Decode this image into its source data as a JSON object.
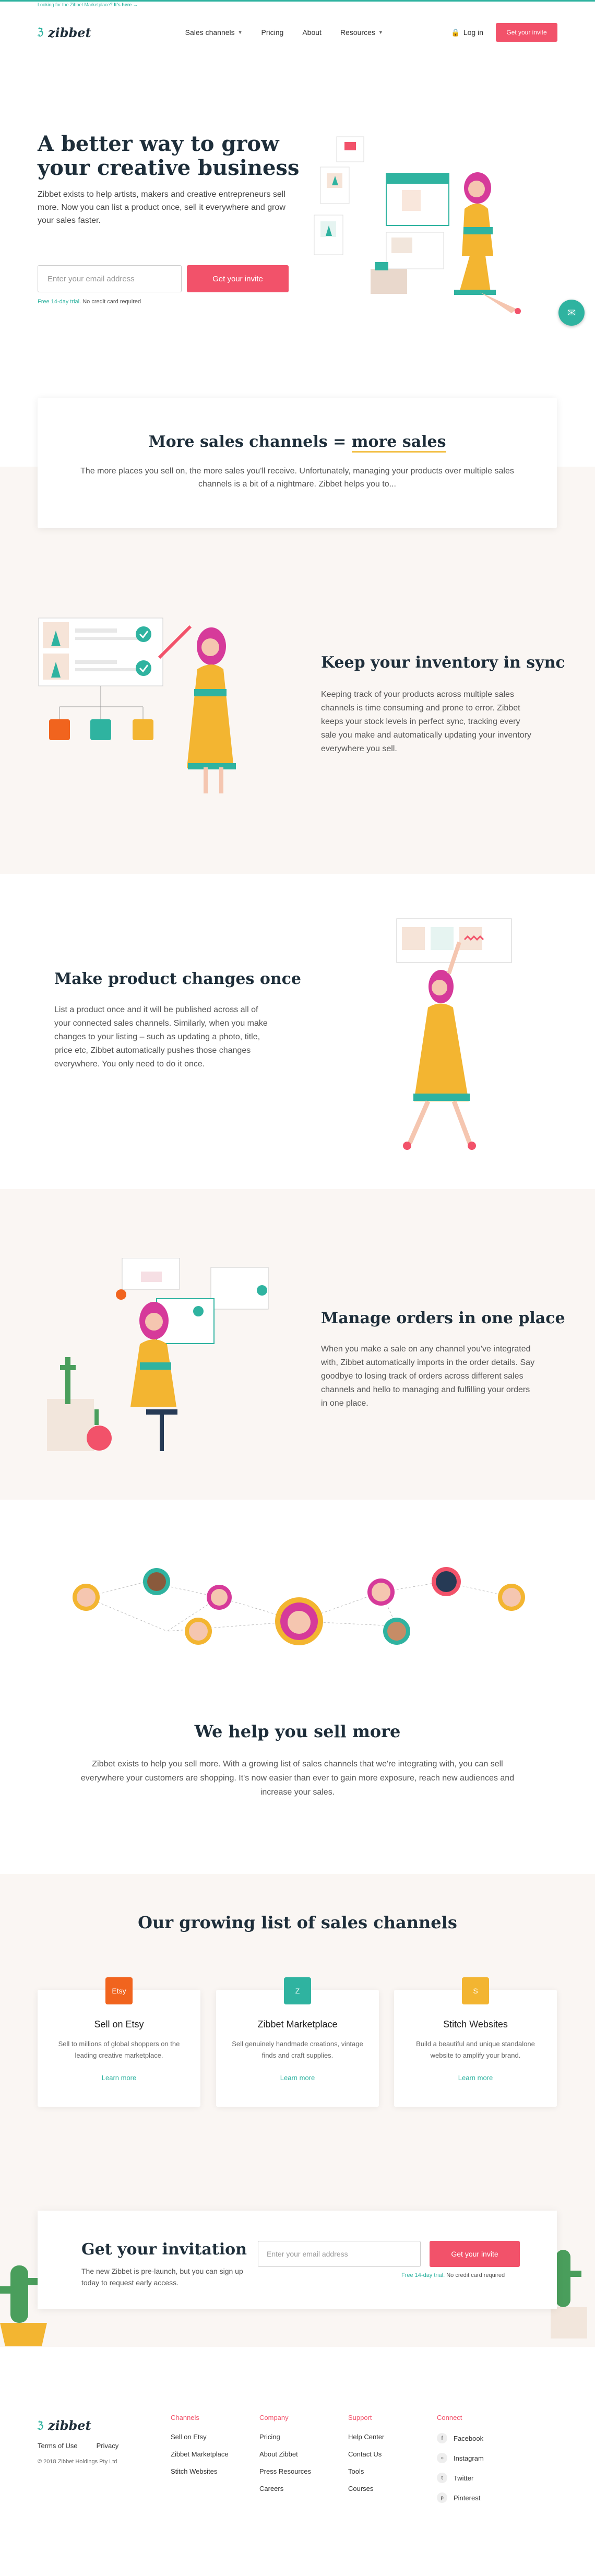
{
  "topbar": {
    "text": "Looking for the Zibbet Marketplace?",
    "link": "It's here →"
  },
  "header": {
    "brand": "zibbet",
    "nav": [
      {
        "label": "Sales channels",
        "dropdown": true
      },
      {
        "label": "Pricing"
      },
      {
        "label": "About"
      },
      {
        "label": "Resources",
        "dropdown": true
      }
    ],
    "login": "Log in",
    "cta": "Get your invite"
  },
  "hero": {
    "title": "A better way to grow your creative business",
    "subtitle": "Zibbet exists to help artists, makers and creative entrepreneurs sell more. Now you can list a product once, sell it everywhere and grow your sales faster.",
    "email_placeholder": "Enter your email address",
    "cta": "Get your invite",
    "hint_strong": "Free 14-day trial.",
    "hint": "No credit card required"
  },
  "more": {
    "title_a": "More sales channels",
    "title_eq": "=",
    "title_b": "more sales",
    "text": "The more places you sell on, the more sales you'll receive. Unfortunately, managing your products over multiple sales channels is a bit of a nightmare. Zibbet helps you to..."
  },
  "features": [
    {
      "title": "Keep your inventory in sync",
      "text": "Keeping track of your products across multiple sales channels is time consuming and prone to error. Zibbet keeps your stock levels in perfect sync, tracking every sale you make and automatically updating your inventory everywhere you sell."
    },
    {
      "title": "Make product changes once",
      "text": "List a product once and it will be published across all of your connected sales channels. Similarly, when you make changes to your listing – such as updating a photo, title, price etc, Zibbet automatically pushes those changes everywhere. You only need to do it once."
    },
    {
      "title": "Manage orders in one place",
      "text": "When you make a sale on any channel you've integrated with, Zibbet automatically imports in the order details. Say goodbye to losing track of orders across different sales channels and hello to managing and fulfilling your orders in one place."
    }
  ],
  "sell": {
    "title": "We help you sell more",
    "text": "Zibbet exists to help you sell more. With a growing list of sales channels that we're integrating with, you can sell everywhere your customers are shopping. It's now easier than ever to gain more exposure, reach new audiences and increase your sales."
  },
  "channels": {
    "title": "Our growing list of sales channels",
    "items": [
      {
        "icon_text": "Etsy",
        "icon_color": "#f1641e",
        "name": "Sell on Etsy",
        "desc": "Sell to millions of global shoppers on the leading creative marketplace.",
        "link": "Learn more"
      },
      {
        "icon_text": "Z",
        "icon_color": "#2fb3a0",
        "name": "Zibbet Marketplace",
        "desc": "Sell genuinely handmade creations, vintage finds and craft supplies.",
        "link": "Learn more"
      },
      {
        "icon_text": "S",
        "icon_color": "#f3b531",
        "name": "Stitch Websites",
        "desc": "Build a beautiful and unique standalone website to amplify your brand.",
        "link": "Learn more"
      }
    ]
  },
  "invite": {
    "title": "Get your invitation",
    "text": "The new Zibbet is pre-launch, but you can sign up today to request early access.",
    "email_placeholder": "Enter your email address",
    "cta": "Get your invite",
    "hint_strong": "Free 14-day trial.",
    "hint": "No credit card required"
  },
  "footer": {
    "brand": "zibbet",
    "links": [
      "Terms of Use",
      "Privacy"
    ],
    "copyright": "© 2018 Zibbet Holdings Pty Ltd",
    "columns": [
      {
        "title": "Channels",
        "items": [
          "Sell on Etsy",
          "Zibbet Marketplace",
          "Stitch Websites"
        ]
      },
      {
        "title": "Company",
        "items": [
          "Pricing",
          "About Zibbet",
          "Press Resources",
          "Careers"
        ]
      },
      {
        "title": "Support",
        "items": [
          "Help Center",
          "Contact Us",
          "Tools",
          "Courses"
        ]
      },
      {
        "title": "Connect",
        "items": [
          "Facebook",
          "Instagram",
          "Twitter",
          "Pinterest"
        ]
      }
    ]
  },
  "colors": {
    "accent": "#2fb3a0",
    "cta": "#f2526a",
    "beige": "#faf6f3",
    "navy": "#1e2e3a",
    "yellow": "#f3c14b"
  }
}
